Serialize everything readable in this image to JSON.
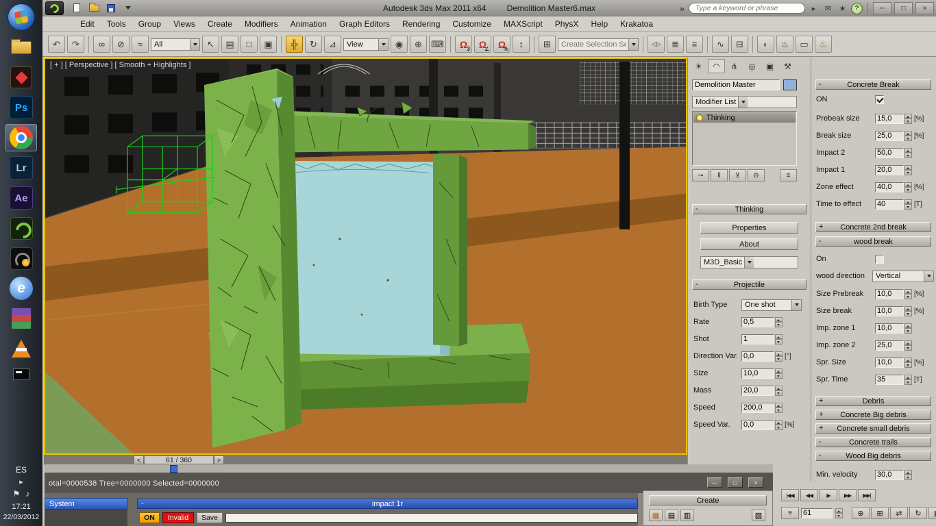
{
  "taskbar": {
    "ps": "Ps",
    "lr": "Lr",
    "ae": "Ae",
    "ie": "e",
    "language": "ES",
    "time": "17:21",
    "date": "22/03/2012"
  },
  "titlebar": {
    "app_title": "Autodesk 3ds Max 2011 x64",
    "doc_title": "Demolition Master6.max",
    "search_placeholder": "Type a keyword or phrase"
  },
  "menu": {
    "items": [
      "Edit",
      "Tools",
      "Group",
      "Views",
      "Create",
      "Modifiers",
      "Animation",
      "Graph Editors",
      "Rendering",
      "Customize",
      "MAXScript",
      "PhysX",
      "Help",
      "Krakatoa"
    ]
  },
  "toolbar": {
    "filter_value": "All",
    "coord_value": "View",
    "selset_value": "Create Selection Se"
  },
  "viewport": {
    "label": "[ + ] [ Perspective ] [ Smooth + Highlights ]",
    "time_slider_value": "61 / 360"
  },
  "panel": {
    "object_name": "Demolition Master",
    "modifier_list": "Modifier List",
    "stack_item": "Thinking",
    "thinking_title": "Thinking",
    "thinking_sign": "-",
    "properties_label": "Properties",
    "about_label": "About",
    "preset_value": "M3D_Basic",
    "projectile_title": "Projectile",
    "projectile_sign": "-",
    "birth_label": "Birth Type",
    "birth_value": "One shot",
    "fields": [
      {
        "label": "Rate",
        "value": "0,5",
        "unit": ""
      },
      {
        "label": "Shot",
        "value": "1",
        "unit": ""
      },
      {
        "label": "Direction Var.",
        "value": "0,0",
        "unit": "[°]"
      },
      {
        "label": "Size",
        "value": "10,0",
        "unit": ""
      },
      {
        "label": "Mass",
        "value": "20,0",
        "unit": ""
      },
      {
        "label": "Speed",
        "value": "200,0",
        "unit": ""
      },
      {
        "label": "Speed Var.",
        "value": "0,0",
        "unit": "[%]"
      }
    ]
  },
  "dm": {
    "cb_title": "Concrete Break",
    "cb_sign": "-",
    "cb_on_label": "ON",
    "cb_fields": [
      {
        "label": "Prebeak size",
        "value": "15,0",
        "unit": "[%]"
      },
      {
        "label": "Break size",
        "value": "25,0",
        "unit": "[%]"
      },
      {
        "label": "Impact 2",
        "value": "50,0",
        "unit": ""
      },
      {
        "label": "Impact 1",
        "value": "20,0",
        "unit": ""
      },
      {
        "label": "Zone effect",
        "value": "40,0",
        "unit": "[%]"
      },
      {
        "label": "Time to effect",
        "value": "40",
        "unit": "[T]"
      }
    ],
    "c2_title": "Concrete 2nd break",
    "c2_sign": "+",
    "wb_title": "wood break",
    "wb_sign": "-",
    "wb_on_label": "On",
    "wb_dir_label": "wood direction",
    "wb_dir_value": "Vertical",
    "wb_fields": [
      {
        "label": "Size Prebreak",
        "value": "10,0",
        "unit": "[%]"
      },
      {
        "label": "Size break",
        "value": "10,0",
        "unit": "[%]"
      },
      {
        "label": "Imp. zone 1",
        "value": "10,0",
        "unit": ""
      },
      {
        "label": "Imp. zone 2",
        "value": "25,0",
        "unit": ""
      },
      {
        "label": "Spr. Size",
        "value": "10,0",
        "unit": "[%]"
      },
      {
        "label": "Spr. Time",
        "value": "35",
        "unit": "[T]"
      }
    ],
    "collapsed": [
      {
        "sign": "+",
        "title": "Debris"
      },
      {
        "sign": "+",
        "title": "Concrete Big debris"
      },
      {
        "sign": "+",
        "title": "Concrete small debris"
      },
      {
        "sign": "-",
        "title": "Concrete trails"
      },
      {
        "sign": "-",
        "title": "Wood Big debris"
      }
    ],
    "minvel_label": "Min. velocity",
    "minvel_value": "30,0"
  },
  "tp": {
    "status": "otal=0000538  Tree=0000000  Selected=0000000",
    "system": "System",
    "rollout_sign": "-",
    "rollout": "impact 1r",
    "on": "ON",
    "invalid": "Invalid",
    "save": "Save"
  },
  "bottom": {
    "create": "Create",
    "frame": "61"
  },
  "icons": {
    "undo": "↶",
    "redo": "↷",
    "link": "∞",
    "unlink": "⊘",
    "bind": "≈",
    "select": "↖",
    "byname": "▤",
    "region": "□",
    "wincross": "▣",
    "move": "╬",
    "rotate": "↻",
    "scale": "⊿",
    "pivot": "◉",
    "manip": "⊕",
    "kbd": "⌨",
    "magnet": "Ω",
    "snap3": "3",
    "angle": "∠",
    "percent": "%",
    "spinsnap": "↕",
    "selset": "⊞",
    "mirror": "◁▷",
    "align": "≣",
    "layers": "≡",
    "curve": "∿",
    "schem": "⊟",
    "material": "◐",
    "teapot": "♨",
    "rframe": "▭",
    "overflow": "»",
    "searchgo": "▸",
    "mail": "✉",
    "star": "★",
    "help": "?",
    "min": "─",
    "restore": "□",
    "close": "×",
    "tab_create": "☀",
    "tab_modify": "◠",
    "tab_hier": "⋔",
    "tab_motion": "◎",
    "tab_display": "▣",
    "tab_util": "⚒",
    "pin": "⊸",
    "showend": "‖",
    "unique": "⊻",
    "remove": "⊖",
    "config": "≡",
    "tsprev": "<",
    "tsnext": ">",
    "p1": "|◀◀",
    "p2": "◀◀",
    "p3": "▶",
    "p4": "▶▶",
    "p5": "▶▶|",
    "zoom": "⊕",
    "zoomall": "⊞",
    "pan": "⇄",
    "orbit": "↻",
    "maxvp": "▣",
    "flag": "⚑",
    "vol": "♪",
    "expand": "▸",
    "g1": "▦",
    "g2": "▤",
    "g3": "▥",
    "g4": "▨"
  }
}
